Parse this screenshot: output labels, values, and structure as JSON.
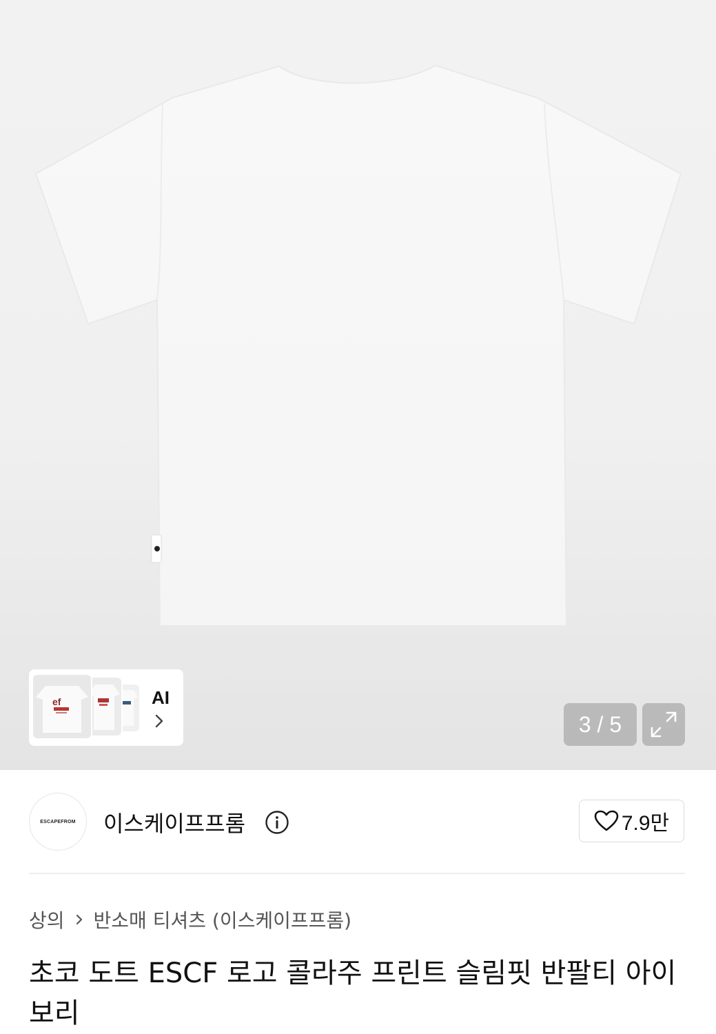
{
  "gallery": {
    "counter": "3 / 5",
    "ai_label": "AI"
  },
  "brand": {
    "logo_text": "ESCAPEFROM",
    "name": "이스케이프프롬"
  },
  "like": {
    "count": "7.9만"
  },
  "breadcrumb": {
    "category": "상의",
    "subcategory": "반소매 티셔츠 (이스케이프프롬)"
  },
  "product": {
    "title": "초코 도트 ESCF 로고 콜라주 프린트 슬림핏 반팔티 아이보리"
  },
  "icons": {
    "info": "info-icon",
    "heart": "heart-icon",
    "expand": "expand-icon",
    "chevron": "chevron-right-icon"
  },
  "colors": {
    "image_background": "#f0f0f0",
    "shirt": "#f7f7f7",
    "overlay": "#969696"
  }
}
